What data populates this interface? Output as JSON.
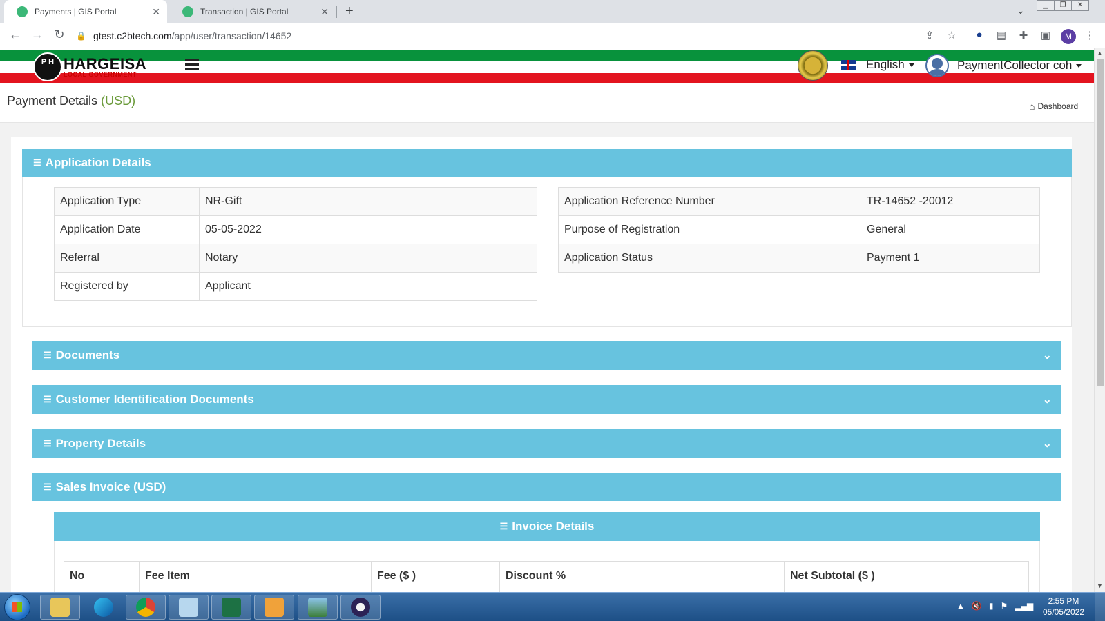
{
  "browser": {
    "tabs": [
      {
        "title": "Payments | GIS Portal",
        "active": true
      },
      {
        "title": "Transaction | GIS Portal",
        "active": false
      }
    ],
    "url_host": "gtest.c2btech.com",
    "url_path": "/app/user/transaction/14652",
    "profile_initial": "M"
  },
  "header": {
    "logo_name": "HARGEISA",
    "logo_sub": "LOCAL GOVERNMENT",
    "language": "English",
    "user_name": "PaymentCollector coh"
  },
  "page": {
    "title": "Payment Details",
    "currency": "(USD)",
    "breadcrumb": "Dashboard"
  },
  "sections": {
    "application_details": "Application Details",
    "documents": "Documents",
    "customer_id_docs": "Customer Identification Documents",
    "property_details": "Property Details",
    "sales_invoice": "Sales Invoice (USD)",
    "invoice_details": "Invoice Details"
  },
  "application": {
    "left": [
      {
        "label": "Application Type",
        "value": "NR-Gift"
      },
      {
        "label": "Application Date",
        "value": "05-05-2022"
      },
      {
        "label": "Referral",
        "value": "Notary"
      },
      {
        "label": "Registered by",
        "value": "Applicant"
      }
    ],
    "right": [
      {
        "label": "Application Reference Number",
        "value": "TR-14652 -20012"
      },
      {
        "label": "Purpose of Registration",
        "value": "General"
      },
      {
        "label": "Application Status",
        "value": "Payment 1"
      }
    ]
  },
  "invoice_columns": [
    "No",
    "Fee Item",
    "Fee ($ )",
    "Discount %",
    "Net Subtotal ($ )"
  ],
  "taskbar": {
    "time": "2:55 PM",
    "date": "05/05/2022"
  },
  "colors": {
    "panel": "#67c3df",
    "stripe_green": "#08923c",
    "stripe_red": "#e3141f",
    "currency_text": "#6a9a3a"
  }
}
